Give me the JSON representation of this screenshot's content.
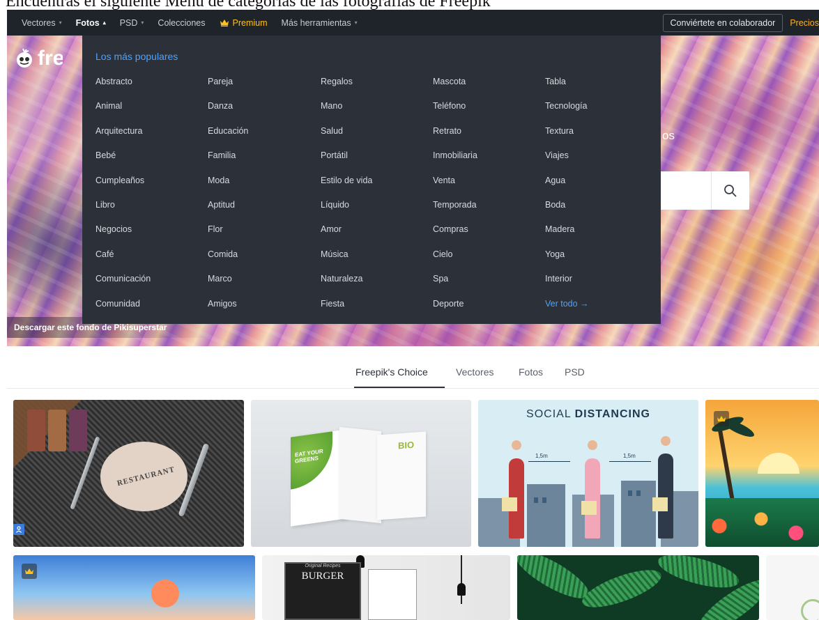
{
  "caption": "Encuentras el siguiente Menú de categorías de las fotografías de Freepik",
  "nav": {
    "items": [
      {
        "label": "Vectores",
        "caret": "▾"
      },
      {
        "label": "Fotos",
        "caret": "▴"
      },
      {
        "label": "PSD",
        "caret": "▾"
      },
      {
        "label": "Colecciones"
      },
      {
        "label": "Premium"
      },
      {
        "label": "Más herramientas",
        "caret": "▾"
      }
    ],
    "contributor_label": "Conviértete en colaborador",
    "prices_label": "Precios"
  },
  "hero": {
    "logo_text": "freepik",
    "subtitle_fragment": "os",
    "credit": "Descargar este fondo de Pikisuperstar"
  },
  "dropdown": {
    "title": "Los más populares",
    "columns": [
      [
        "Abstracto",
        "Animal",
        "Arquitectura",
        "Bebé",
        "Cumpleaños",
        "Libro",
        "Negocios",
        "Café",
        "Comunicación",
        "Comunidad"
      ],
      [
        "Pareja",
        "Danza",
        "Educación",
        "Familia",
        "Moda",
        "Aptitud",
        "Flor",
        "Comida",
        "Marco",
        "Amigos"
      ],
      [
        "Regalos",
        "Mano",
        "Salud",
        "Portátil",
        "Estilo de vida",
        "Líquido",
        "Amor",
        "Música",
        "Naturaleza",
        "Fiesta"
      ],
      [
        "Mascota",
        "Teléfono",
        "Retrato",
        "Inmobiliaria",
        "Venta",
        "Temporada",
        "Compras",
        "Cielo",
        "Spa",
        "Deporte"
      ],
      [
        "Tabla",
        "Tecnología",
        "Textura",
        "Viajes",
        "Agua",
        "Boda",
        "Madera",
        "Yoga",
        "Interior",
        "Ver todo →"
      ]
    ]
  },
  "tabs": [
    "Freepik's Choice",
    "Vectores",
    "Fotos",
    "PSD"
  ],
  "gallery": {
    "restaurant_text": "RESTAURANT",
    "brochure_text": "EAT YOUR GREENS",
    "brochure_bio": "BIO",
    "social_title_light": "SOCIAL",
    "social_title_bold": "DISTANCING",
    "distance_label": "1,5m",
    "board_sub": "Original Recipes",
    "board_title": "BURGER"
  },
  "colors": {
    "nav_bg": "#1f242b",
    "dropdown_bg": "#2c3139",
    "accent_blue": "#4aa4ff",
    "premium_gold": "#ffc21a"
  }
}
